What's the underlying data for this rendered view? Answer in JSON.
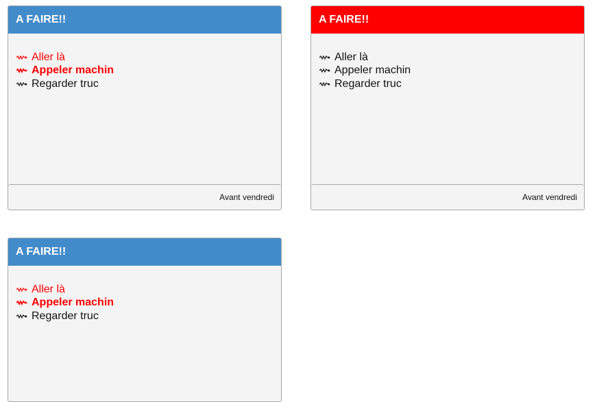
{
  "cards": [
    {
      "title": "A FAIRE!!",
      "header_color": "#428bca",
      "items": [
        {
          "label": "Aller là",
          "color": "red",
          "bold": false
        },
        {
          "label": "Appeler machin",
          "color": "red",
          "bold": true
        },
        {
          "label": "Regarder truc",
          "color": "black",
          "bold": false
        }
      ],
      "footer": "Avant vendredi"
    },
    {
      "title": "A FAIRE!!",
      "header_color": "#ff0000",
      "items": [
        {
          "label": "Aller là",
          "color": "black",
          "bold": false
        },
        {
          "label": "Appeler machin",
          "color": "black",
          "bold": false
        },
        {
          "label": "Regarder truc",
          "color": "black",
          "bold": false
        }
      ],
      "footer": "Avant vendredi"
    },
    {
      "title": "A FAIRE!!",
      "header_color": "#428bca",
      "items": [
        {
          "label": "Aller là",
          "color": "red",
          "bold": false
        },
        {
          "label": "Appeler machin",
          "color": "red",
          "bold": true
        },
        {
          "label": "Regarder truc",
          "color": "black",
          "bold": false
        }
      ],
      "footer": ""
    }
  ],
  "colors": {
    "accent_blue": "#428bca",
    "accent_red": "#ff0000",
    "panel_bg": "#f4f4f4"
  }
}
